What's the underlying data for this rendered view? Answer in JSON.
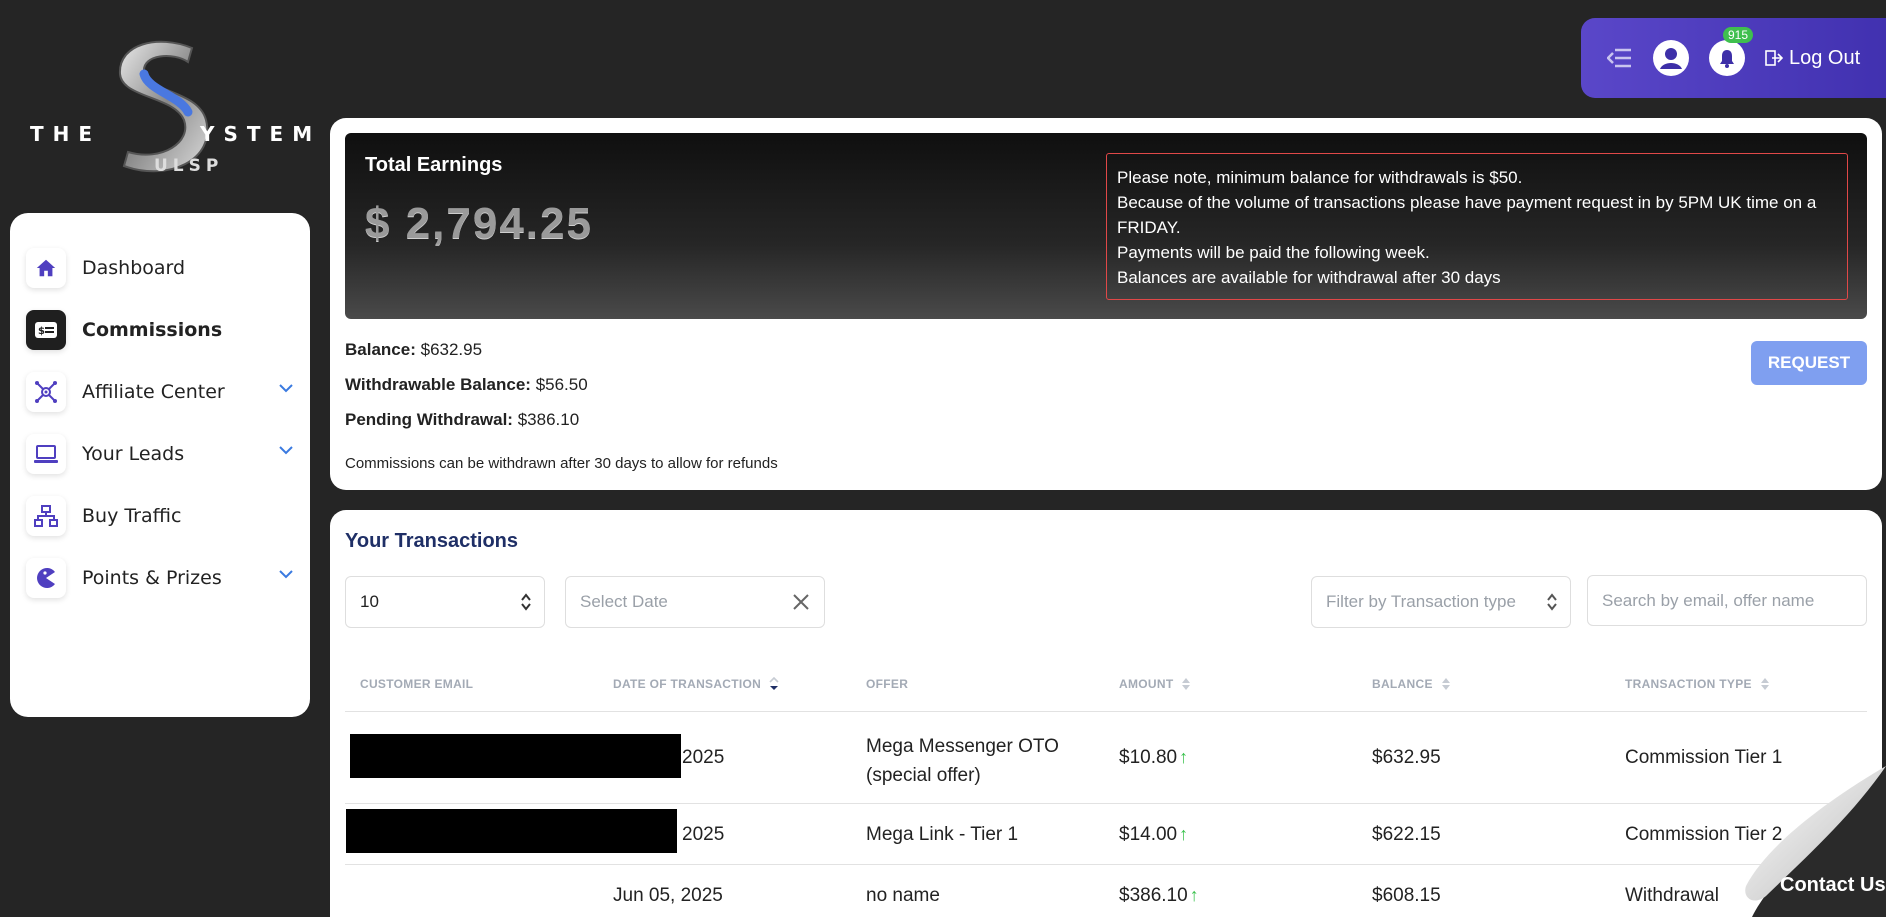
{
  "logo": {
    "left": "THE",
    "right": "YSTEM",
    "sub": "ULSP"
  },
  "topbar": {
    "notification_count": "915",
    "logout_label": "Log Out"
  },
  "sidebar": {
    "items": [
      {
        "label": "Dashboard",
        "icon": "home-icon"
      },
      {
        "label": "Commissions",
        "icon": "money-card-icon"
      },
      {
        "label": "Affiliate Center",
        "icon": "network-icon"
      },
      {
        "label": "Your Leads",
        "icon": "laptop-icon"
      },
      {
        "label": "Buy Traffic",
        "icon": "sitemap-icon"
      },
      {
        "label": "Points & Prizes",
        "icon": "pacman-icon"
      }
    ]
  },
  "earnings": {
    "title": "Total Earnings",
    "amount": "$ 2,794.25",
    "notice": [
      "Please note, minimum balance for withdrawals is $50.",
      "Because of the volume of transactions please have payment request in by 5PM UK time on a FRIDAY.",
      "Payments will be paid the following week.",
      "Balances are available for withdrawal after 30 days"
    ],
    "balance_label": "Balance:",
    "balance_value": "$632.95",
    "withdrawable_label": "Withdrawable Balance:",
    "withdrawable_value": "$56.50",
    "pending_label": "Pending Withdrawal:",
    "pending_value": "$386.10",
    "note": "Commissions can be withdrawn after 30 days to allow for refunds",
    "request_label": "REQUEST"
  },
  "transactions": {
    "title": "Your Transactions",
    "page_size": "10",
    "date_placeholder": "Select Date",
    "type_placeholder": "Filter by Transaction type",
    "search_placeholder": "Search by email, offer name",
    "columns": [
      "CUSTOMER EMAIL",
      "DATE OF TRANSACTION",
      "OFFER",
      "AMOUNT",
      "BALANCE",
      "TRANSACTION TYPE"
    ],
    "rows": [
      {
        "email": "",
        "date": "2025",
        "offer": "Mega Messenger OTO (special offer)",
        "amount": "$10.80",
        "balance": "$632.95",
        "type": "Commission Tier 1"
      },
      {
        "email": "",
        "date": "2025",
        "offer": "Mega Link - Tier 1",
        "amount": "$14.00",
        "balance": "$622.15",
        "type": "Commission Tier 2"
      },
      {
        "email": "",
        "date": "Jun 05, 2025",
        "offer": "no name",
        "amount": "$386.10",
        "balance": "$608.15",
        "type": "Withdrawal"
      }
    ]
  },
  "contact": {
    "label": "Contact Us"
  },
  "colors": {
    "accent": "#4f3fc0",
    "request": "#7f9ff0",
    "notice_border": "#e04848",
    "title_blue": "#1f2f66",
    "up_arrow": "#3cc24f"
  }
}
